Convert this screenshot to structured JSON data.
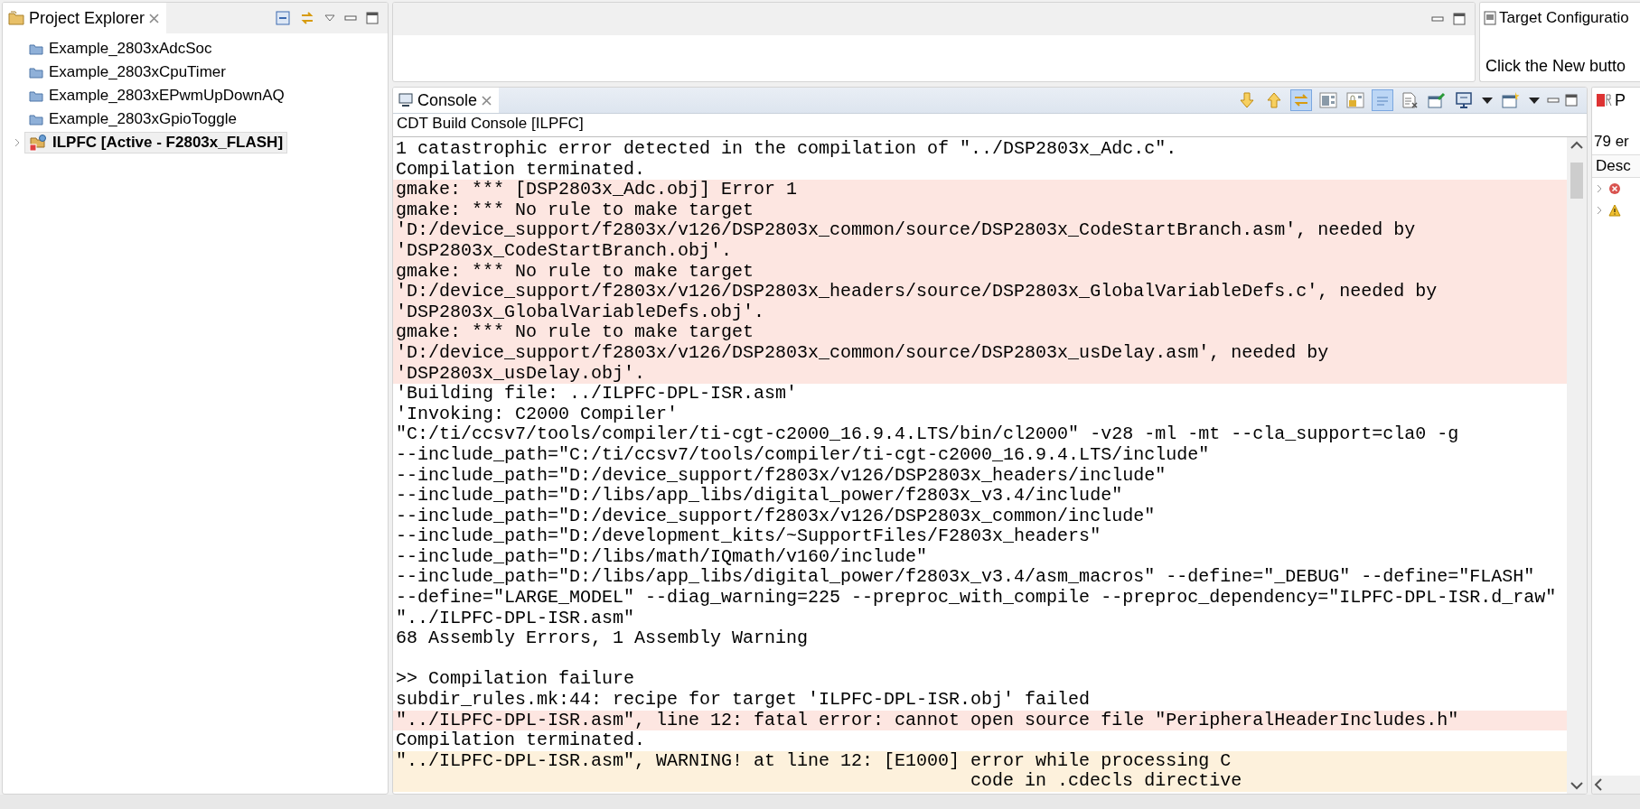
{
  "project_explorer": {
    "title": "Project Explorer",
    "items": [
      {
        "label": "Example_2803xAdcSoc",
        "kind": "folder",
        "selected": false
      },
      {
        "label": "Example_2803xCpuTimer",
        "kind": "folder",
        "selected": false
      },
      {
        "label": "Example_2803xEPwmUpDownAQ",
        "kind": "folder",
        "selected": false
      },
      {
        "label": "Example_2803xGpioToggle",
        "kind": "folder",
        "selected": false
      },
      {
        "label": "ILPFC  [Active - F2803x_FLASH]",
        "kind": "project",
        "selected": true
      }
    ]
  },
  "target_configurations": {
    "title": "Target Configuratio",
    "message": "Click the New butto"
  },
  "console": {
    "title": "Console",
    "subtitle": "CDT Build Console [ILPFC]",
    "toolbar": [
      {
        "kind": "next",
        "on": false
      },
      {
        "kind": "previous",
        "on": false
      },
      {
        "kind": "link",
        "on": true
      },
      {
        "kind": "grid",
        "on": false
      },
      {
        "kind": "lock",
        "on": false
      },
      {
        "kind": "wrap",
        "on": true
      },
      {
        "kind": "clear",
        "on": false
      },
      {
        "kind": "pin",
        "on": false
      },
      {
        "kind": "display",
        "on": false
      },
      {
        "kind": "dropdown",
        "on": false
      },
      {
        "kind": "new",
        "on": false
      },
      {
        "kind": "dropdown",
        "on": false
      }
    ],
    "lines": [
      {
        "text": "1 catastrophic error detected in the compilation of \"../DSP2803x_Adc.c\".",
        "kind": "normal"
      },
      {
        "text": "Compilation terminated.",
        "kind": "normal"
      },
      {
        "text": "gmake: *** [DSP2803x_Adc.obj] Error 1",
        "kind": "error"
      },
      {
        "text": "gmake: *** No rule to make target",
        "kind": "error"
      },
      {
        "text": "'D:/device_support/f2803x/v126/DSP2803x_common/source/DSP2803x_CodeStartBranch.asm', needed by",
        "kind": "error"
      },
      {
        "text": "'DSP2803x_CodeStartBranch.obj'.",
        "kind": "error"
      },
      {
        "text": "gmake: *** No rule to make target",
        "kind": "error"
      },
      {
        "text": "'D:/device_support/f2803x/v126/DSP2803x_headers/source/DSP2803x_GlobalVariableDefs.c', needed by",
        "kind": "error"
      },
      {
        "text": "'DSP2803x_GlobalVariableDefs.obj'.",
        "kind": "error"
      },
      {
        "text": "gmake: *** No rule to make target",
        "kind": "error"
      },
      {
        "text": "'D:/device_support/f2803x/v126/DSP2803x_common/source/DSP2803x_usDelay.asm', needed by",
        "kind": "error"
      },
      {
        "text": "'DSP2803x_usDelay.obj'.",
        "kind": "error"
      },
      {
        "text": "'Building file: ../ILPFC-DPL-ISR.asm'",
        "kind": "normal"
      },
      {
        "text": "'Invoking: C2000 Compiler'",
        "kind": "normal"
      },
      {
        "text": "\"C:/ti/ccsv7/tools/compiler/ti-cgt-c2000_16.9.4.LTS/bin/cl2000\" -v28 -ml -mt --cla_support=cla0 -g",
        "kind": "normal"
      },
      {
        "text": "--include_path=\"C:/ti/ccsv7/tools/compiler/ti-cgt-c2000_16.9.4.LTS/include\"",
        "kind": "normal"
      },
      {
        "text": "--include_path=\"D:/device_support/f2803x/v126/DSP2803x_headers/include\"",
        "kind": "normal"
      },
      {
        "text": "--include_path=\"D:/libs/app_libs/digital_power/f2803x_v3.4/include\"",
        "kind": "normal"
      },
      {
        "text": "--include_path=\"D:/device_support/f2803x/v126/DSP2803x_common/include\"",
        "kind": "normal"
      },
      {
        "text": "--include_path=\"D:/development_kits/~SupportFiles/F2803x_headers\"",
        "kind": "normal"
      },
      {
        "text": "--include_path=\"D:/libs/math/IQmath/v160/include\"",
        "kind": "normal"
      },
      {
        "text": "--include_path=\"D:/libs/app_libs/digital_power/f2803x_v3.4/asm_macros\" --define=\"_DEBUG\" --define=\"FLASH\"",
        "kind": "normal"
      },
      {
        "text": "--define=\"LARGE_MODEL\" --diag_warning=225 --preproc_with_compile --preproc_dependency=\"ILPFC-DPL-ISR.d_raw\"",
        "kind": "normal"
      },
      {
        "text": "\"../ILPFC-DPL-ISR.asm\"",
        "kind": "normal"
      },
      {
        "text": "68 Assembly Errors, 1 Assembly Warning",
        "kind": "normal"
      },
      {
        "kind": "blank"
      },
      {
        "text": ">> Compilation failure",
        "kind": "normal"
      },
      {
        "text": "subdir_rules.mk:44: recipe for target 'ILPFC-DPL-ISR.obj' failed",
        "kind": "normal"
      },
      {
        "text": "\"../ILPFC-DPL-ISR.asm\", line 12: fatal error: cannot open source file \"PeripheralHeaderIncludes.h\"",
        "kind": "error"
      },
      {
        "text": "Compilation terminated.",
        "kind": "normal"
      },
      {
        "text": "\"../ILPFC-DPL-ISR.asm\", WARNING! at line 12: [E1000] error while processing C",
        "kind": "warning"
      },
      {
        "text": "code in .cdecls directive",
        "kind": "warning-continued"
      }
    ]
  },
  "problems": {
    "title": "P",
    "summary": "79 er",
    "column": "Desc",
    "rows": [
      {
        "kind": "error"
      },
      {
        "kind": "warning"
      }
    ]
  }
}
